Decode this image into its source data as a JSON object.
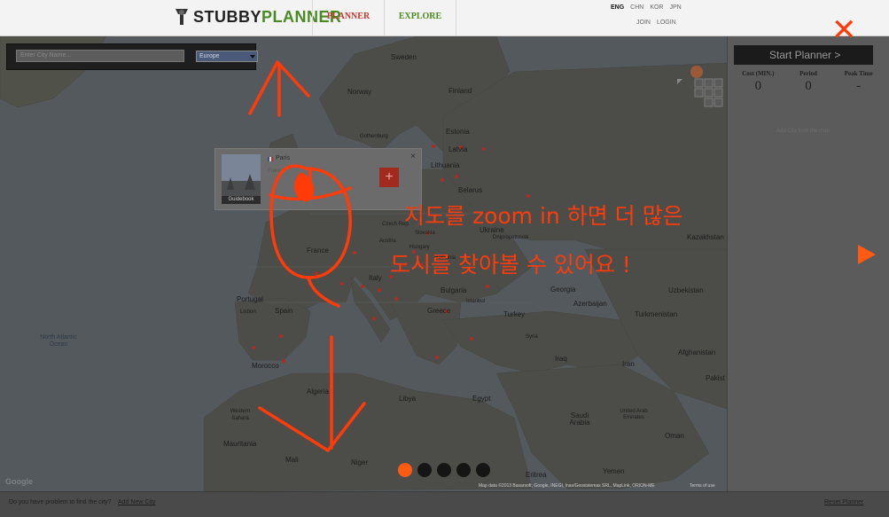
{
  "header": {
    "logo_part1": "STUBBY",
    "logo_part2": "PLANNER",
    "nav": {
      "planner": "PLANNER",
      "explore": "EXPLORE"
    },
    "languages": [
      "ENG",
      "CHN",
      "KOR",
      "JPN"
    ],
    "active_language": "ENG",
    "join": "JOIN",
    "login": "LOGIN"
  },
  "search": {
    "placeholder": "Enter City Name...",
    "region": "Europe"
  },
  "map_labels": {
    "sweden": "Sweden",
    "norway": "Norway",
    "finland": "Finland",
    "estonia": "Estonia",
    "latvia": "Latvia",
    "lithuania": "Lithuania",
    "belarus": "Belarus",
    "ukraine": "Ukraine",
    "france": "France",
    "czech": "Czech Rep.",
    "slovakia": "Slovakia",
    "austria": "Austria",
    "hungary": "Hungary",
    "romania": "Romania",
    "bulgaria": "Bulgaria",
    "italy": "Italy",
    "portugal": "Portugal",
    "spain": "Spain",
    "greece": "Greece",
    "turkey": "Turkey",
    "georgia": "Georgia",
    "azerbaijan": "Azerbaijan",
    "kazakhstan": "Kazakhstan",
    "uzbekistan": "Uzbekistan",
    "turkmenistan": "Turkmenistan",
    "afghanistan": "Afghanistan",
    "iran": "Iran",
    "iraq": "Iraq",
    "syria": "Syria",
    "pakistan": "Pakist",
    "morocco": "Morocco",
    "algeria": "Algeria",
    "libya": "Libya",
    "egypt": "Egypt",
    "saudi": "Saudi Arabia",
    "uae": "United Arab Emirates",
    "oman": "Oman",
    "yemen": "Yemen",
    "eritrea": "Eritrea",
    "mauritania": "Mauritania",
    "western_sahara": "Western Sahara",
    "mali": "Mali",
    "niger": "Niger",
    "dnipro": "Dnipropetrovsk",
    "istanbul": "Istanbul",
    "lisbon": "Lisbon",
    "gothenburg": "Gothenburg",
    "north_atlantic": "North Atlantic Ocean"
  },
  "popup": {
    "city": "Paris",
    "subtitle": "France",
    "guidebook": "Guidebook",
    "add": "+",
    "close": "×"
  },
  "panel": {
    "start_button": "Start Planner >",
    "cost_label": "Cost (MIN.)",
    "cost_value": "0",
    "period_label": "Period",
    "period_value": "0",
    "peak_label": "Peak Time",
    "peak_value": "-",
    "hint": "Add City from the map"
  },
  "footer": {
    "prompt": "Do you have problem to find the city?",
    "add_city": "Add New City",
    "reset": "Reset Planner",
    "map_data": "Map data ©2013 Basarsoft, Google, INEGI, Inav/Geosistemas SRL, MapLink, ORION-ME",
    "terms": "Terms of use",
    "google": "Google"
  },
  "overlay": {
    "note_line1": "지도를 zoom in 하면 더 많은",
    "note_line2": "도시를 찾아볼 수 있어요 !",
    "close": "✕",
    "carousel_total": 5,
    "carousel_active": 1
  },
  "colors": {
    "accent": "#ff5a12",
    "handwriting": "#ff3b0a",
    "logo_green": "#4a8a23",
    "planner_red": "#c0392b"
  }
}
